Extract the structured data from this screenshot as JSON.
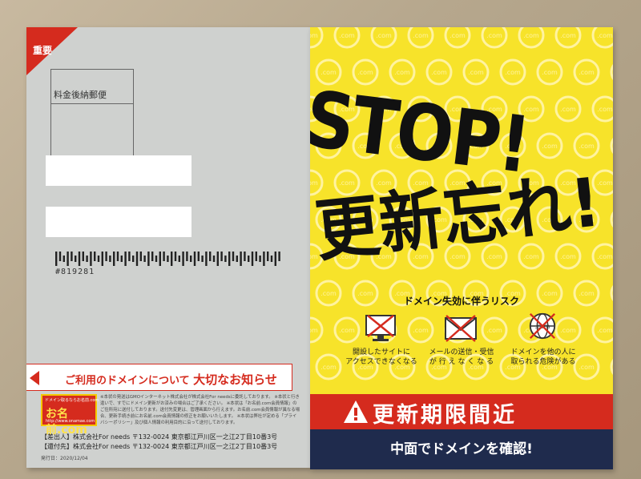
{
  "envelope": {
    "juyo_label": "重要",
    "postage_label": "料金後納郵便",
    "barcode_number": "#819281",
    "notice": {
      "pre": "ご利用のドメインについて",
      "strong": "大切なお知らせ"
    },
    "logo": {
      "small": "ドメイン取るならお名前.com",
      "main": "お名前.com",
      "url": "http://www.onamae.com"
    },
    "fine_print": "※本状の発送はGMOインターネット株式会社が株式会社For needsに委託しております。 ※本状と行き違いで、すでにドメイン更新がお済みの場合はご了承ください。 ※本状は「お名前.com会員情報」のご住所宛に送付しております。送付先変更は、管理画面から行えます。お名前.com会員情報が異なる場合、更新手続き前にお名前.com会員情報の修正をお願いいたします。 ※本状は弊社が定める「プライバシーポリシー」及び個人情報の利用目的に沿って送付しております。",
    "sender1": "【差出人】株式会社For needs 〒132-0024 東京都江戸川区一之江2丁目10番3号",
    "sender2": "【還付先】株式会社For needs 〒132-0024 東京都江戸川区一之江2丁目10番3号",
    "issued": "発行日：2020/12/04"
  },
  "flyer": {
    "stop": "STOP!",
    "koushin": "更新忘れ!",
    "risk_title": "ドメイン失効に伴うリスク",
    "risks": [
      {
        "icon": "monitor-x-icon",
        "line1": "開設したサイトに",
        "line2": "アクセスできなくなる"
      },
      {
        "icon": "mail-x-icon",
        "line1": "メールの送信・受信",
        "line2": "が 行 え な く な る"
      },
      {
        "icon": "globe-x-icon",
        "line1": "ドメインを他の人に",
        "line2": "取られる危険がある"
      }
    ],
    "deadline": "更新期限間近",
    "check": "中面でドメインを確認!",
    "pattern_text": ".com"
  },
  "colors": {
    "yellow": "#f7e32a",
    "red": "#d52b1e",
    "navy": "#1f2b4d",
    "envelope_gray": "#cfd1cf"
  }
}
